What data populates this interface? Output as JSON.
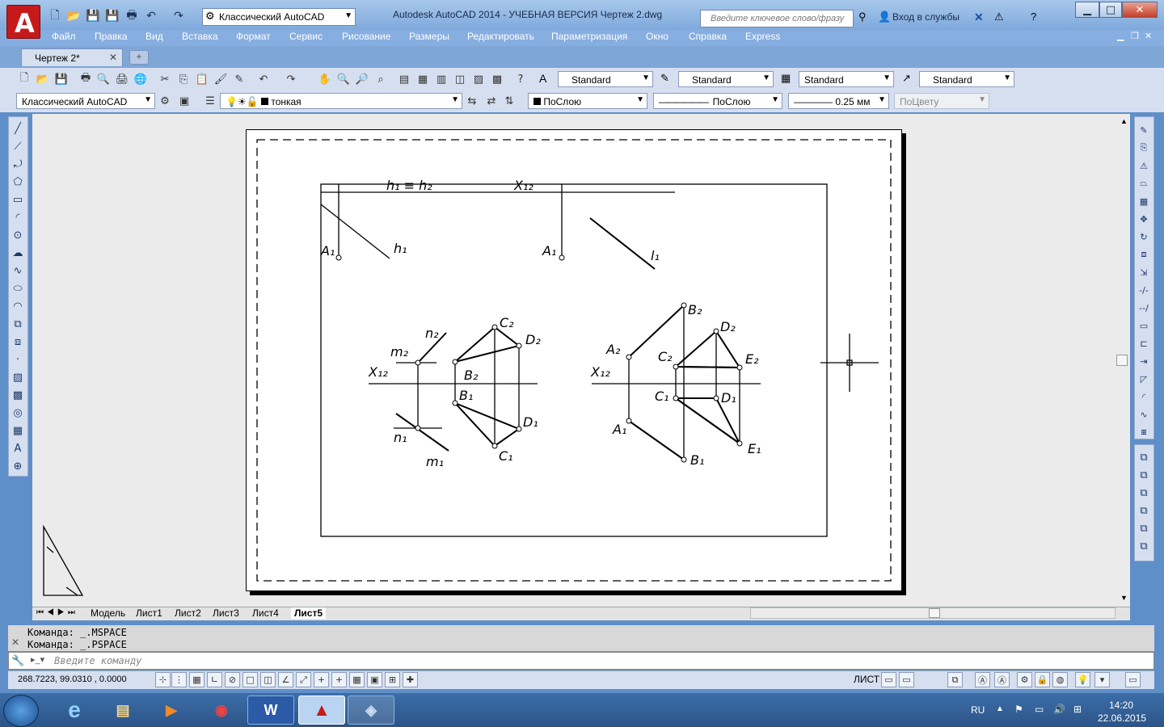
{
  "window": {
    "title": "Autodesk AutoCAD 2014 - УЧЕБНАЯ ВЕРСИЯ      Чертеж 2.dwg",
    "workspace": "Классический AutoCAD",
    "search_placeholder": "Введите ключевое слово/фразу",
    "signin": "Вход в службы",
    "logo_letter": "A"
  },
  "menu": [
    "Файл",
    "Правка",
    "Вид",
    "Вставка",
    "Формат",
    "Сервис",
    "Рисование",
    "Размеры",
    "Редактировать",
    "Параметризация",
    "Окно",
    "Справка",
    "Express"
  ],
  "doc_tab": {
    "label": "Чертеж 2*",
    "close": "✕",
    "new": "+"
  },
  "styles_toolbar": {
    "text_style": "Standard",
    "dim_style": "Standard",
    "table_style": "Standard",
    "mleader_style": "Standard"
  },
  "layers_toolbar": {
    "workspace": "Классический AutoCAD",
    "layer": "тонкая",
    "color": "ПоСлою",
    "linetype": "ПоСлою",
    "lineweight": "0.25 мм",
    "plotstyle": "ПоЦвету"
  },
  "layout_tabs": [
    "Модель",
    "Лист1",
    "Лист2",
    "Лист3",
    "Лист4",
    "Лист5"
  ],
  "command_history": [
    "Команда:  _.MSPACE",
    "Команда:  _.PSPACE"
  ],
  "command_placeholder": "Введите команду",
  "status": {
    "coords": "268.7223,  99.0310 , 0.0000",
    "space": "ЛИСТ"
  },
  "taskbar": {
    "lang": "RU",
    "time": "14:20",
    "date": "22.06.2015"
  },
  "drawing_labels": {
    "h1_header": "h₁ ≡ h₂",
    "x12_header": "X₁₂",
    "a1_left": "A₁",
    "h1": "h₁",
    "a1_right": "A₁",
    "l1": "l₁",
    "n2": "n₂",
    "m2": "m₂",
    "x12_left": "X₁₂",
    "c2_left": "C₂",
    "d2_left": "D₂",
    "b2_left": "B₂",
    "b1_left": "B₁",
    "d1_left": "D₁",
    "n1": "n₁",
    "m1": "m₁",
    "c1_left": "C₁",
    "b2_right": "B₂",
    "d2_right": "D₂",
    "a2_right": "A₂",
    "c2_right": "C₂",
    "e2_right": "E₂",
    "x12_right": "X₁₂",
    "c1_right": "C₁",
    "d1_right": "D₁",
    "a1_right2": "A₁",
    "e1_right": "E₁",
    "b1_right": "B₁"
  },
  "colors": {
    "titlebar": "#a8c8ec",
    "toolbar": "#d6dff0",
    "canvas": "#ebebeb",
    "taskbar": "#2c5488",
    "logo": "#c61a1a"
  }
}
